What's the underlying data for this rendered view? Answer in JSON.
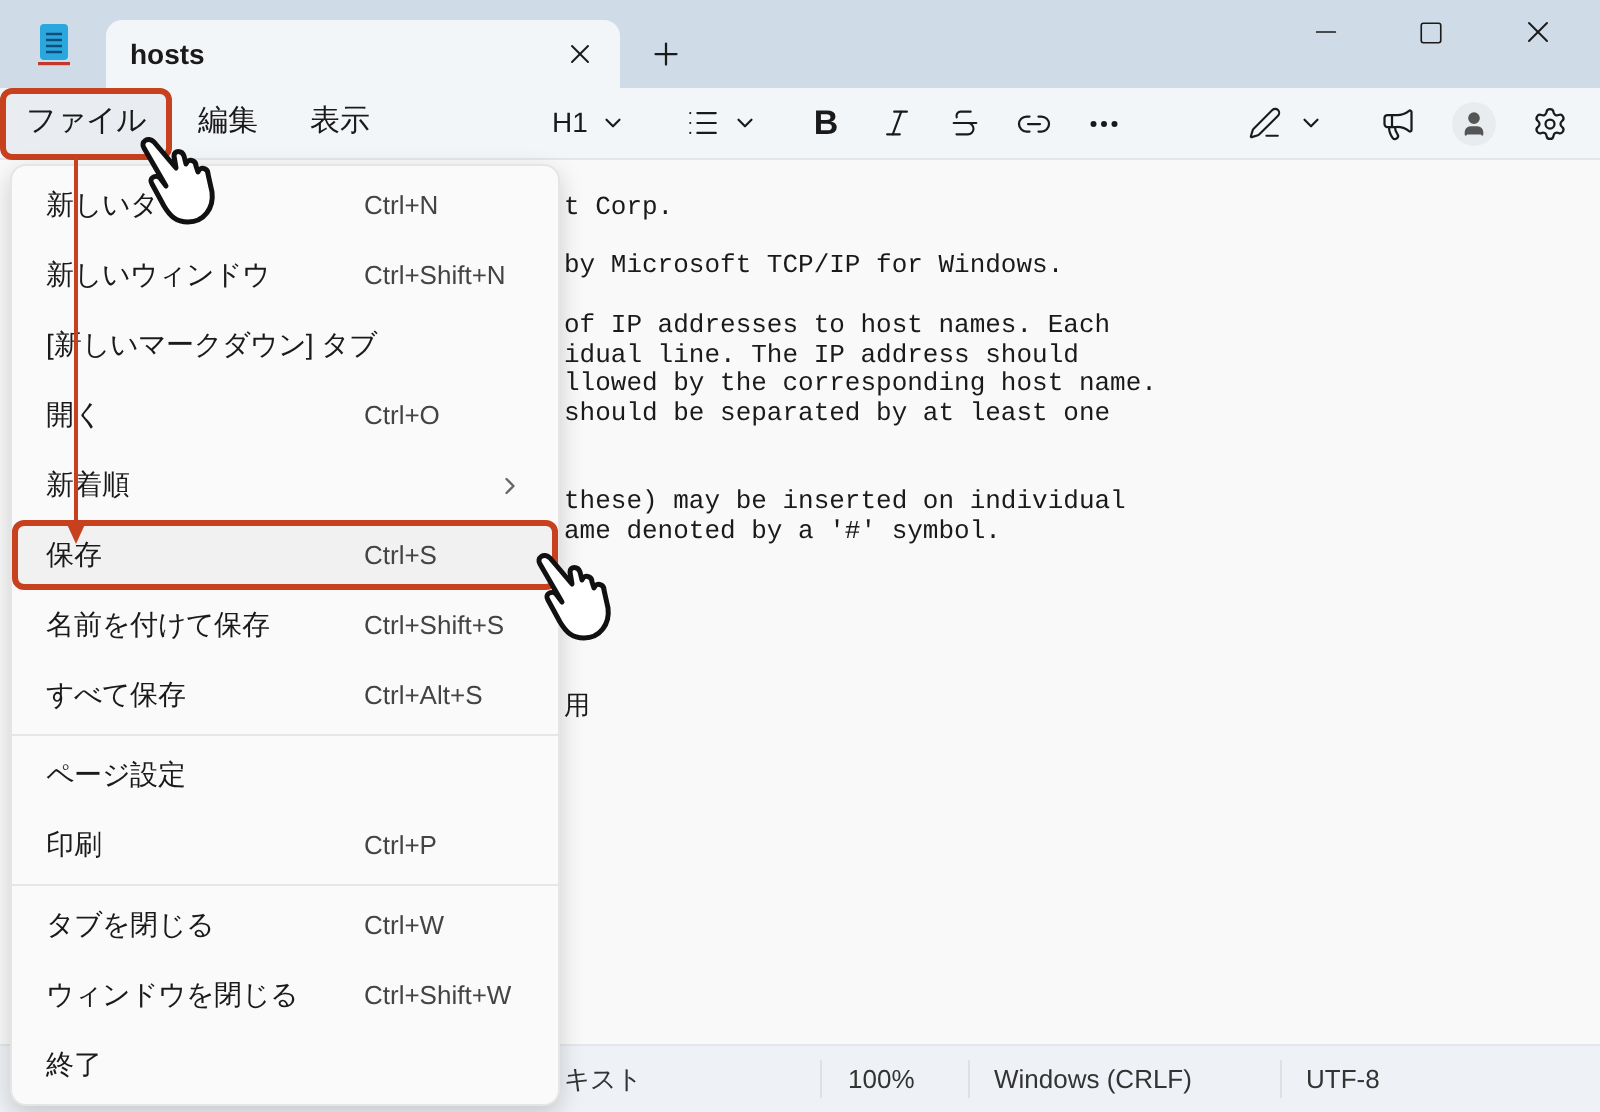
{
  "window": {
    "title": "hosts"
  },
  "menubar": [
    {
      "label": "ファイル",
      "highlighted": true
    },
    {
      "label": "編集",
      "highlighted": false
    },
    {
      "label": "表示",
      "highlighted": false
    }
  ],
  "format_toolbar": {
    "heading": "H1",
    "bold": "B"
  },
  "editor": {
    "lines": [
      "t Corp.",
      "by Microsoft TCP/IP for Windows.",
      "of IP addresses to host names. Each",
      "idual line. The IP address should",
      "llowed by the corresponding host name.",
      "should be separated by at least one",
      "these) may be inserted on individual",
      "ame denoted by a '#' symbol.",
      "用"
    ]
  },
  "file_menu": {
    "groups": [
      [
        {
          "label": "新しいタ",
          "shortcut": "Ctrl+N",
          "submenu": false,
          "highlighted": false
        },
        {
          "label": "新しいウィンドウ",
          "shortcut": "Ctrl+Shift+N",
          "submenu": false,
          "highlighted": false
        },
        {
          "label": "[新しいマークダウン] タブ",
          "submenu": false,
          "highlighted": false
        },
        {
          "label": "開く",
          "shortcut": "Ctrl+O",
          "submenu": false,
          "highlighted": false
        },
        {
          "label": "新着順",
          "submenu": true,
          "highlighted": false
        },
        {
          "label": "保存",
          "shortcut": "Ctrl+S",
          "submenu": false,
          "highlighted": true
        },
        {
          "label": "名前を付けて保存",
          "shortcut": "Ctrl+Shift+S",
          "submenu": false,
          "highlighted": false
        },
        {
          "label": "すべて保存",
          "shortcut": "Ctrl+Alt+S",
          "submenu": false,
          "highlighted": false
        }
      ],
      [
        {
          "label": "ページ設定",
          "submenu": false,
          "highlighted": false
        },
        {
          "label": "印刷",
          "shortcut": "Ctrl+P",
          "submenu": false,
          "highlighted": false
        }
      ],
      [
        {
          "label": "タブを閉じる",
          "shortcut": "Ctrl+W",
          "submenu": false,
          "highlighted": false
        },
        {
          "label": "ウィンドウを閉じる",
          "shortcut": "Ctrl+Shift+W",
          "submenu": false,
          "highlighted": false
        },
        {
          "label": "終了",
          "submenu": false,
          "highlighted": false
        }
      ]
    ]
  },
  "status_bar": [
    "キスト",
    "100%",
    "Windows (CRLF)",
    "UTF-8"
  ]
}
